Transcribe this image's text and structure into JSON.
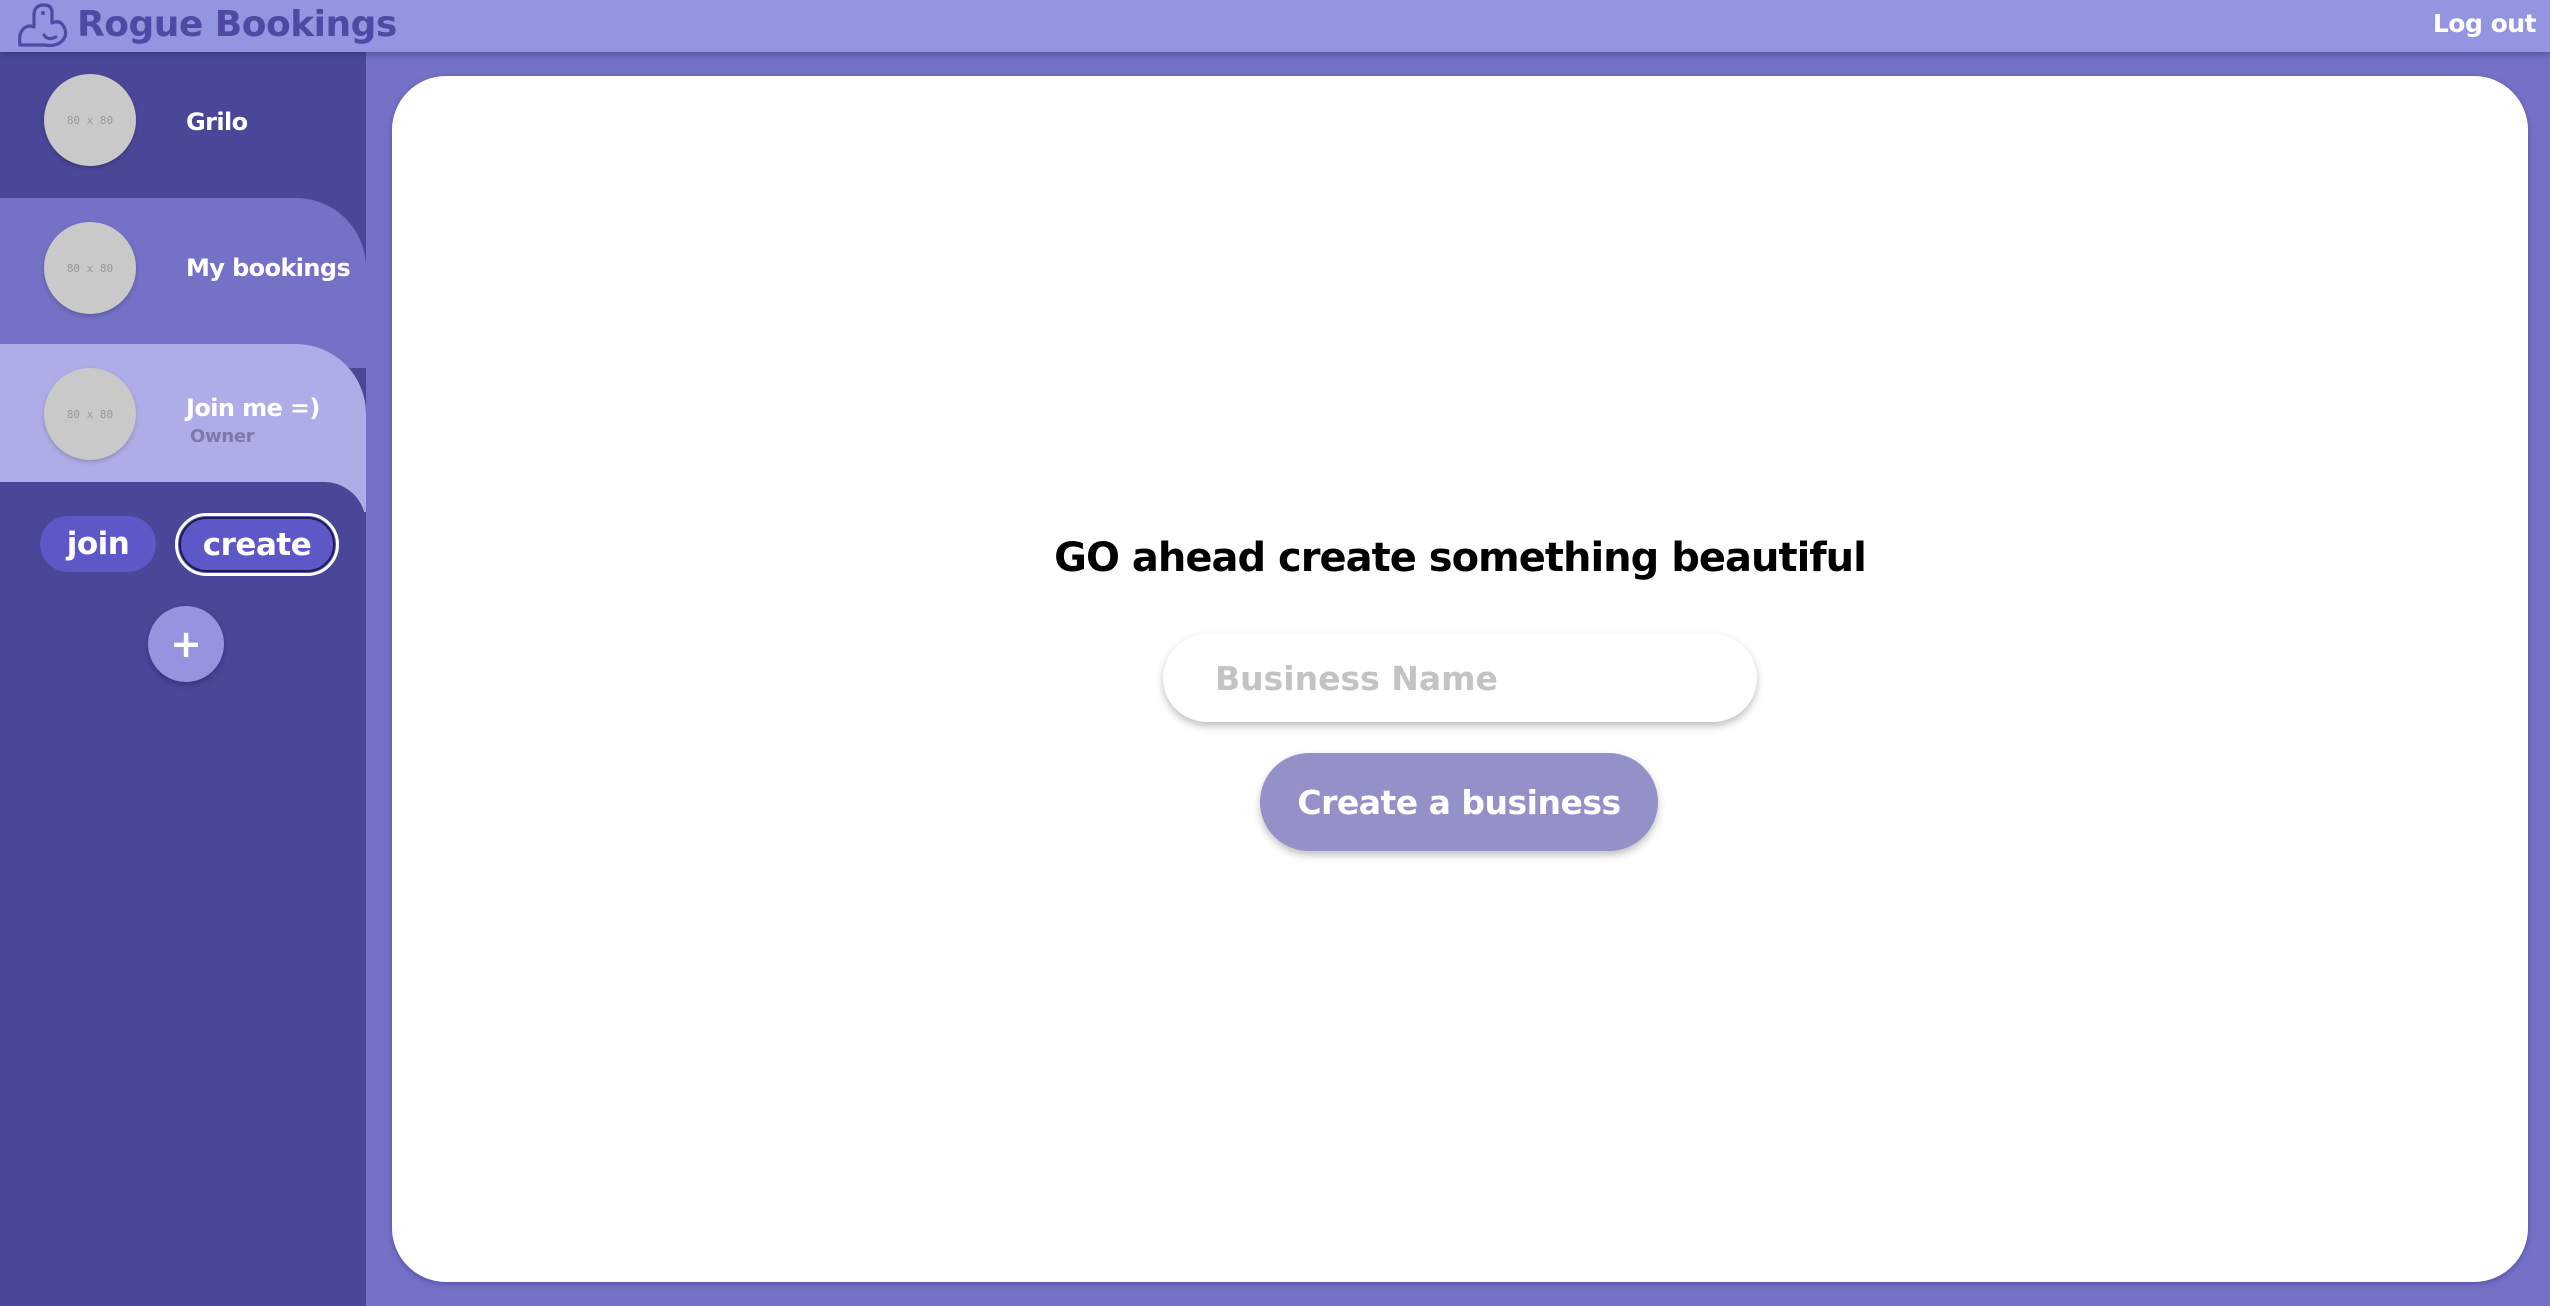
{
  "header": {
    "brand": "Rogue Bookings",
    "logout_label": "Log out",
    "logo_icon": "duck-logo-icon"
  },
  "sidebar": {
    "items": [
      {
        "name": "Grilo",
        "avatar_text": "80 x 80",
        "role": ""
      },
      {
        "name": "My bookings",
        "avatar_text": "80 x 80",
        "role": ""
      },
      {
        "name": "Join me =)",
        "avatar_text": "80 x 80",
        "role": "Owner",
        "selected": true
      }
    ],
    "join_label": "join",
    "create_label": "create",
    "add_label": "+"
  },
  "main": {
    "headline": "GO ahead create something beautiful",
    "input_placeholder": "Business Name",
    "input_value": "",
    "submit_label": "Create a business"
  },
  "colors": {
    "topbar": "#9495e0",
    "brand_text": "#4e4aa3",
    "sidebar": "#4a4799",
    "background": "#7471c7",
    "selected_item": "#aeade8",
    "button": "#5d57c8",
    "submit_button": "#9491c9"
  }
}
